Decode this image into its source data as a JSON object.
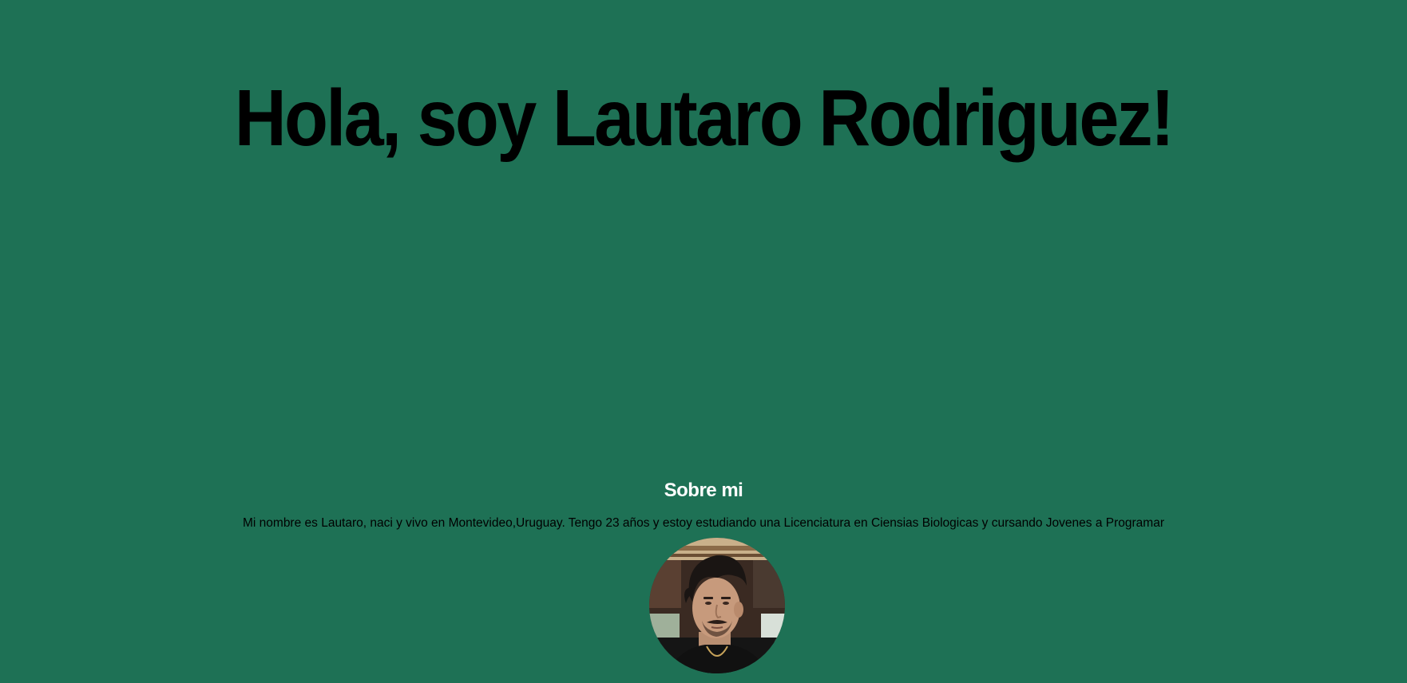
{
  "hero": {
    "title": "Hola, soy Lautaro Rodriguez!"
  },
  "about": {
    "heading": "Sobre mi",
    "text": "Mi nombre es Lautaro, naci y vivo en Montevideo,Uruguay. Tengo 23 años y estoy estudiando una Licenciatura en Ciensias Biologicas y cursando Jovenes a Programar"
  },
  "colors": {
    "background": "#1e7155",
    "title": "#000000",
    "heading": "#ffffff",
    "body_text": "#000000"
  },
  "icons": {
    "avatar": "profile-photo"
  }
}
